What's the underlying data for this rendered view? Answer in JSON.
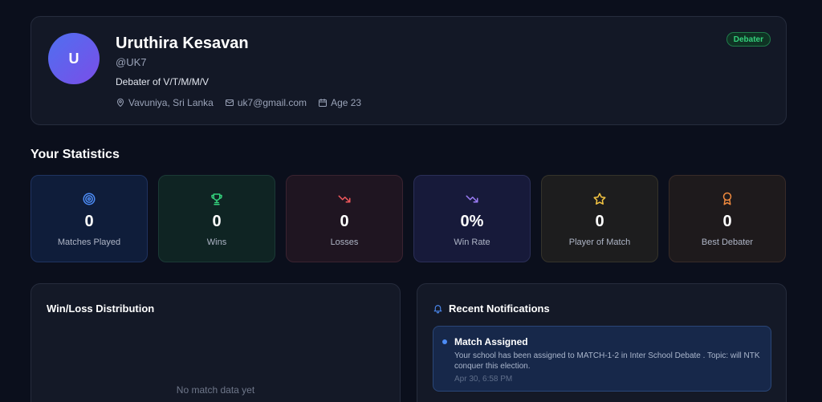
{
  "profile": {
    "avatar_initial": "U",
    "name": "Uruthira Kesavan",
    "handle": "@UK7",
    "bio": "Debater of V/T/M/M/V",
    "location": "Vavuniya, Sri Lanka",
    "email": "uk7@gmail.com",
    "age": "Age 23",
    "role_badge": "Debater",
    "icons": [
      "map-pin-icon",
      "mail-icon",
      "calendar-icon"
    ]
  },
  "statistics": {
    "title": "Your Statistics",
    "cards": [
      {
        "value": "0",
        "label": "Matches Played",
        "icon": "target-icon",
        "color": "#4d8cf5"
      },
      {
        "value": "0",
        "label": "Wins",
        "icon": "trophy-icon",
        "color": "#34d17c"
      },
      {
        "value": "0",
        "label": "Losses",
        "icon": "trending-down-icon",
        "color": "#f0585c"
      },
      {
        "value": "0%",
        "label": "Win Rate",
        "icon": "trending-down-icon",
        "color": "#9b7cf6"
      },
      {
        "value": "0",
        "label": "Player of Match",
        "icon": "star-icon",
        "color": "#f5c542"
      },
      {
        "value": "0",
        "label": "Best Debater",
        "icon": "award-icon",
        "color": "#f08a3e"
      }
    ]
  },
  "win_loss": {
    "title": "Win/Loss Distribution",
    "empty_text": "No match data yet"
  },
  "notifications": {
    "title": "Recent Notifications",
    "items": [
      {
        "title": "Match Assigned",
        "body": "Your school has been assigned to MATCH-1-2 in Inter School Debate . Topic: will NTK conquer this election.",
        "time": "Apr 30, 6:58 PM"
      }
    ]
  }
}
